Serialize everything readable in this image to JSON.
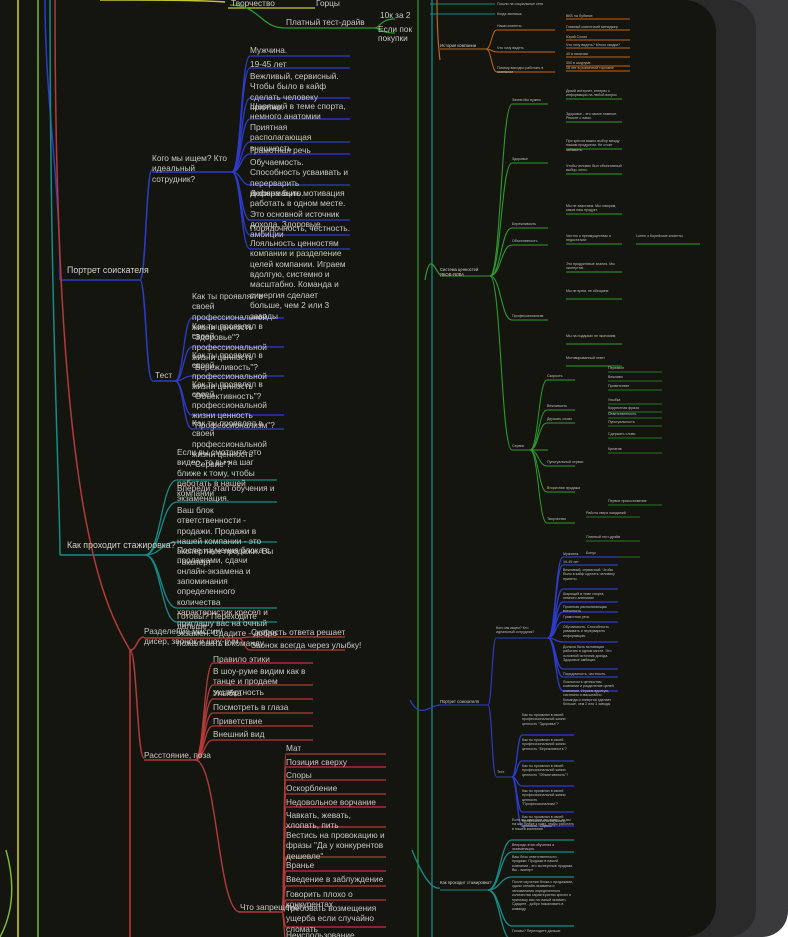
{
  "colors": {
    "bg": "#151510",
    "yellow": "#c9c53a",
    "blue": "#2d3cc8",
    "teal": "#178a86",
    "red": "#b23a3a",
    "green": "#2f9a2f",
    "orange": "#c0651e",
    "lime": "#7fbf30",
    "text": "#c9c9c2"
  },
  "left": {
    "top": {
      "n1": "Творчество",
      "n2": "Горцы",
      "n3": "Платный тест-драйв",
      "n4": "10к за 2",
      "n5": "Если пок",
      "n6": "покупки"
    },
    "portrait": {
      "label": "Портрет соискателя",
      "who": "Кого мы ищем? Кто идеальный сотрудник?",
      "who_items": [
        "Мужчина.",
        "19-45 лет",
        "Вежливый, сервисный. Чтобы было в кайф сделать человеку приятно.",
        "Шарящий в теме спорта, немного анатомии",
        "Приятная располагающая внешность",
        "Грамотная речь",
        "Обучаемость. Способность усваивать и перерварить информацию.",
        "Должна быть мотивация работать в одном месте. Это основной источник дохода. Здоровые амбиции",
        "Порядочность, честность.",
        "Лояльность ценностям компании и разделение целей компании. Играем вдолгую, системно и масштабно. Команда и синергия сделает больше, чем 2 или 3 заводы"
      ],
      "test": "Тест",
      "test_items": [
        "Как ты проявлял в своей профессиональной жизни ценность \"Здоровье\"?",
        "Как ты проявлял в своей профессиональной жизни ценность \"Бережливость\"?",
        "Как ты проявлял в своей профессиональной жизни ценность \"Объективность\"?",
        "Как ты проявлял в своей профессиональной жизни ценность \"Профессионализм\"?",
        "Как ты проявлял в своей профессиональной жизни ценность \"Сервис\"?"
      ]
    },
    "internship": {
      "label": "Как проходит стажировка?",
      "items": [
        "Если вы смотрите это видео, то вы на шаг ближе к тому, чтобы работать в нашей компании",
        "Впереди этап обучения и экзаменация.",
        "Ваш блок ответственности - продажи. Продажи в нашей компании - это экспертные продажи. Вы - эксперт",
        "После изучения блока с продажами, сдачи онлайн-экзамена и запоминания определенного количества характеристик кресел и приглашу вас на очный экзамен. Сдадите - добро пожаловать в команду",
        "Готовы? Переходите дальше"
      ]
    },
    "red": {
      "top": "Разделение миссии/дисер, звонок и шоу-рум",
      "top_items": [
        "Скорость ответа решает",
        "Звонок всегда через улыбку!"
      ],
      "items": [
        "Правило этики",
        "В шоу-руме видим как в танце и продаем экспертность",
        "Улыбка",
        "Посмотреть в глаза",
        "Приветствие",
        "Внешний вид"
      ],
      "posture": "Расстояние, поза",
      "forbidden": "Что запрещено",
      "forbidden_items": [
        "Мат",
        "Позиция сверху",
        "Споры",
        "Оскорбление",
        "Недовольное ворчание",
        "Чавкать, жевать, хлопать, пить",
        "Вестись на провокацию и фразы \"Да у конкурентов дешевле\"",
        "Вранье",
        "Введение в заблуждение",
        "Говорить плохо о конкурентах",
        "Требовать возмещения ущерба если случайно сломать",
        "Неиспользование"
      ]
    }
  },
  "right": {
    "top": {
      "a": "Пошли на социальные сети",
      "b": "Когда звонишь"
    },
    "history": {
      "label": "История компании",
      "items": [
        "Наши клиенты",
        "Что хочу видеть",
        "Почему выгодно работать в компании"
      ],
      "sub": [
        "ВКБ на Лубянке",
        "Главный клиентский менеджер",
        "Юрий Сонин",
        "Что хочу видеть? Много скидки?",
        "40 в наличии",
        "300 в шоуруме",
        "16 лет в розничной торговле"
      ]
    },
    "values_label": "Система ценностей ЯКОВ-ЯЛВА",
    "values": [
      "Зачем Мы нужны",
      "Здоровье",
      "Бережливость",
      "Объективность",
      "Профессионализм",
      "Сервис"
    ],
    "values_notes": [
      "Дикий интернет, интерес к информации на любой вопрос",
      "Здоровье - это самое главное. Ремонт с нами.",
      "Про кресла важно выбор между нашим продуктом. Не стоит забывать.",
      "Чтобы человек был объективный выбор, ключ.",
      "Мы не хвастаем. Мы говорим, каков наш продукт.",
      "Честно о преимуществах и недостатках",
      "Lorem о Корейские клиенты",
      "Это продуктовые знания. Мы экспертны",
      "Мы не врем, не обещаем",
      "Мы на подарках не экономим",
      "Мотивированный ответ"
    ],
    "service": [
      "Скорость",
      "Вежливость",
      "Держать слово",
      "Пунктуальный сервис",
      "Вторичная продажа",
      "Творчество"
    ],
    "service_items": [
      "Перезвон",
      "Вежливо",
      "Приветствие",
      "Улыбка",
      "Корректная фраза",
      "Ответственность",
      "Пунктуальность",
      "Сдержать слово",
      "Креатив",
      "Первое прикосновение",
      "Работа сверх ожиданий",
      "Платный тест-драйв",
      "Бонус"
    ],
    "portrait": {
      "label": "Портрет соискателя",
      "who": "Кого мы ищем? Кто идеальный сотрудник?",
      "who_items": [
        "Мужчина.",
        "19-45 лет",
        "Вежливый, сервисный. Чтобы было в кайф сделать человеку приятно.",
        "Шарящий в теме спорта, немного анатомии",
        "Приятная располагающая внешность",
        "Грамотная речь",
        "Обучаемость. Способность усваивать и перерварить информацию.",
        "Должна быть мотивация работать в одном месте. Это основной источник дохода. Здоровые амбиции",
        "Порядочность, честность.",
        "Лояльность ценностям компании и разделение целей компании. Играем вдолгую, системно и масштабно. Команда и синергия сделает больше, чем 2 или 3 заводы"
      ],
      "test": "Тест",
      "test_items": [
        "Как ты проявлял в своей профессиональной жизни ценность \"Здоровье\"?",
        "Как ты проявлял в своей профессиональной жизни ценность \"Бережливость\"?",
        "Как ты проявлял в своей профессиональной жизни ценность \"Объективность\"?",
        "Как ты проявлял в своей профессиональной жизни ценность \"Профессионализм\"?",
        "Как ты проявлял в своей профессиональной жизни ценность \"Сервис\"?"
      ]
    },
    "internship": {
      "label": "Как проходит стажировка?",
      "items": [
        "Если вы смотрите это видео, то вы на шаг ближе к тому, чтобы работать в нашей компании",
        "Впереди этап обучения и экзаменация.",
        "Ваш блок ответственности - продажи. Продажи в нашей компании - это экспертные продажи. Вы - эксперт",
        "После изучения блока с продажами, сдачи онлайн-экзамена и запоминания определенного количества характеристик кресел и приглашу вас на очный экзамен. Сдадите - добро пожаловать в команду",
        "Готовы? Переходите дальше"
      ]
    }
  }
}
